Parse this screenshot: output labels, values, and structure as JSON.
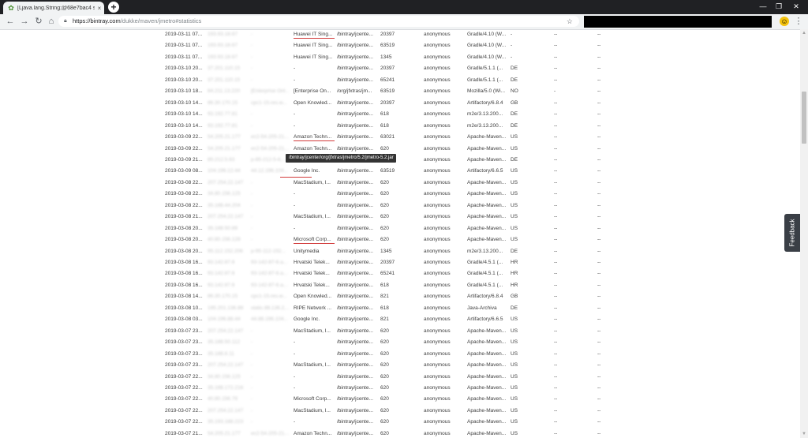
{
  "browser": {
    "tab_title": "[Ljava.lang.String;@68e7bac4 st",
    "tab_close": "×",
    "new_tab": "+",
    "url_host": "https://bintray.com",
    "url_path": "/dukke/maven/jmetro#statistics"
  },
  "tooltip": "/bintray/jcenter/org/jfxtras/jmetro/5.2/jmetro-5.2.jar",
  "feedback_label": "Feedback",
  "table": {
    "rows": [
      {
        "date": "2019-03-11 07...",
        "ip": "193.93.18.67",
        "host": "-",
        "org": "Huawei IT Sing...",
        "path": "/bintray/jcente...",
        "port": "20397",
        "user": "anonymous",
        "agent": "Gradle/4.10 (W...",
        "cc": "-",
        "x1": "--",
        "x2": "--",
        "ul": true
      },
      {
        "date": "2019-03-11 07...",
        "ip": "193.93.18.67",
        "host": "-",
        "org": "Huawei IT Sing...",
        "path": "/bintray/jcente...",
        "port": "63519",
        "user": "anonymous",
        "agent": "Gradle/4.10 (W...",
        "cc": "-",
        "x1": "--",
        "x2": "--",
        "ul": false
      },
      {
        "date": "2019-03-11 07...",
        "ip": "193.93.18.67",
        "host": "-",
        "org": "Huawei IT Sing...",
        "path": "/bintray/jcente...",
        "port": "1345",
        "user": "anonymous",
        "agent": "Gradle/4.10 (W...",
        "cc": "-",
        "x1": "--",
        "x2": "--",
        "ul": false
      },
      {
        "date": "2019-03-10 20...",
        "ip": "37.201.110.15",
        "host": "-",
        "org": "-",
        "path": "/bintray/jcente...",
        "port": "20397",
        "user": "anonymous",
        "agent": "Gradle/5.1.1 (...",
        "cc": "DE",
        "x1": "--",
        "x2": "--",
        "ul": false
      },
      {
        "date": "2019-03-10 20...",
        "ip": "37.201.110.15",
        "host": "-",
        "org": "-",
        "path": "/bintray/jcente...",
        "port": "65241",
        "user": "anonymous",
        "agent": "Gradle/5.1.1 (...",
        "cc": "DE",
        "x1": "--",
        "x2": "--",
        "ul": false
      },
      {
        "date": "2019-03-10 18...",
        "ip": "84.211.13.220",
        "host": "[Enterprise Onl...",
        "org": "[Enterprise On...",
        "path": "/org/jfxtras/jm...",
        "port": "63519",
        "user": "anonymous",
        "agent": "Mozilla/5.0 (Wi...",
        "cc": "NO",
        "x1": "-",
        "x2": "--",
        "ul": false
      },
      {
        "date": "2019-03-10 14...",
        "ip": "86.30.170.15",
        "host": "cpc1-15.res.w...",
        "org": "Open Knowled...",
        "path": "/bintray/jcente...",
        "port": "20397",
        "user": "anonymous",
        "agent": "Artifactory/6.8.4",
        "cc": "GB",
        "x1": "--",
        "x2": "--",
        "ul": false
      },
      {
        "date": "2019-03-10 14...",
        "ip": "93.192.77.81",
        "host": "-",
        "org": "-",
        "path": "/bintray/jcente...",
        "port": "618",
        "user": "anonymous",
        "agent": "m2e/3.13.200...",
        "cc": "DE",
        "x1": "--",
        "x2": "--",
        "ul": false
      },
      {
        "date": "2019-03-10 14...",
        "ip": "93.192.77.81",
        "host": "-",
        "org": "-",
        "path": "/bintray/jcente...",
        "port": "618",
        "user": "anonymous",
        "agent": "m2e/3.13.200...",
        "cc": "DE",
        "x1": "--",
        "x2": "--",
        "ul": false
      },
      {
        "date": "2019-03-09 22...",
        "ip": "54.205.21.177",
        "host": "ec2-54-205-21...",
        "org": "Amazon Techn...",
        "path": "/bintray/jcente...",
        "port": "63021",
        "user": "anonymous",
        "agent": "Apache-Maven...",
        "cc": "US",
        "x1": "--",
        "x2": "--",
        "ul": true
      },
      {
        "date": "2019-03-09 22...",
        "ip": "54.205.21.177",
        "host": "ec2-54-205-21...",
        "org": "Amazon Techn...",
        "path": "/bintray/jcente...",
        "port": "620",
        "user": "anonymous",
        "agent": "Apache-Maven...",
        "cc": "US",
        "x1": "--",
        "x2": "--",
        "ul": false
      },
      {
        "date": "2019-03-09 21...",
        "ip": "85.212.5.63",
        "host": "p-85-212-5-6...",
        "org": "-",
        "path": "/bintray/jcente...",
        "port": "620",
        "user": "anonymous",
        "agent": "Apache-Maven...",
        "cc": "DE",
        "x1": "--",
        "x2": "--",
        "ul": false
      },
      {
        "date": "2019-03-09 08...",
        "ip": "104.196.12.44",
        "host": "44.12.196.104...",
        "org": "Google Inc.",
        "path": "/bintray/jcente...",
        "port": "63519",
        "user": "anonymous",
        "agent": "Artifactory/6.6.5",
        "cc": "US",
        "x1": "--",
        "x2": "--",
        "ul": false
      },
      {
        "date": "2019-03-08 22...",
        "ip": "207.254.22.147",
        "host": "-",
        "org": "MacStadium, I...",
        "path": "/bintray/jcente...",
        "port": "620",
        "user": "anonymous",
        "agent": "Apache-Maven...",
        "cc": "US",
        "x1": "--",
        "x2": "--",
        "ul": false
      },
      {
        "date": "2019-03-08 22...",
        "ip": "34.80.156.125",
        "host": "-",
        "org": "-",
        "path": "/bintray/jcente...",
        "port": "620",
        "user": "anonymous",
        "agent": "Apache-Maven...",
        "cc": "US",
        "x1": "--",
        "x2": "--",
        "ul": false
      },
      {
        "date": "2019-03-08 22...",
        "ip": "35.188.44.204",
        "host": "-",
        "org": "-",
        "path": "/bintray/jcente...",
        "port": "620",
        "user": "anonymous",
        "agent": "Apache-Maven...",
        "cc": "US",
        "x1": "--",
        "x2": "--",
        "ul": false
      },
      {
        "date": "2019-03-08 21...",
        "ip": "207.254.22.147",
        "host": "-",
        "org": "MacStadium, I...",
        "path": "/bintray/jcente...",
        "port": "620",
        "user": "anonymous",
        "agent": "Apache-Maven...",
        "cc": "US",
        "x1": "--",
        "x2": "--",
        "ul": false
      },
      {
        "date": "2019-03-08 20...",
        "ip": "35.188.50.89",
        "host": "-",
        "org": "-",
        "path": "/bintray/jcente...",
        "port": "620",
        "user": "anonymous",
        "agent": "Apache-Maven...",
        "cc": "US",
        "x1": "--",
        "x2": "--",
        "ul": false
      },
      {
        "date": "2019-03-08 20...",
        "ip": "40.80.156.128",
        "host": "-",
        "org": "Microsoft Corp...",
        "path": "/bintray/jcente...",
        "port": "620",
        "user": "anonymous",
        "agent": "Apache-Maven...",
        "cc": "US",
        "x1": "--",
        "x2": "--",
        "ul": true
      },
      {
        "date": "2019-03-08 20...",
        "ip": "95.112.152.206",
        "host": "p-95-112-152...",
        "org": "Unitymedia",
        "path": "/bintray/jcente...",
        "port": "1345",
        "user": "anonymous",
        "agent": "m2e/3.13.200...",
        "cc": "DE",
        "x1": "--",
        "x2": "--",
        "ul": false
      },
      {
        "date": "2019-03-08 16...",
        "ip": "93.142.87.6",
        "host": "93-142-87-6.a...",
        "org": "Hrvatski Telek...",
        "path": "/bintray/jcente...",
        "port": "20397",
        "user": "anonymous",
        "agent": "Gradle/4.5.1 (...",
        "cc": "HR",
        "x1": "--",
        "x2": "--",
        "ul": false
      },
      {
        "date": "2019-03-08 16...",
        "ip": "93.142.87.6",
        "host": "93-142-87-6.a...",
        "org": "Hrvatski Telek...",
        "path": "/bintray/jcente...",
        "port": "65241",
        "user": "anonymous",
        "agent": "Gradle/4.5.1 (...",
        "cc": "HR",
        "x1": "--",
        "x2": "--",
        "ul": false
      },
      {
        "date": "2019-03-08 16...",
        "ip": "93.142.87.6",
        "host": "93-142-87-6.a...",
        "org": "Hrvatski Telek...",
        "path": "/bintray/jcente...",
        "port": "618",
        "user": "anonymous",
        "agent": "Gradle/4.5.1 (...",
        "cc": "HR",
        "x1": "--",
        "x2": "--",
        "ul": false
      },
      {
        "date": "2019-03-08 14...",
        "ip": "86.30.170.15",
        "host": "cpc1-15.res.w...",
        "org": "Open Knowled...",
        "path": "/bintray/jcente...",
        "port": "821",
        "user": "anonymous",
        "agent": "Artifactory/6.8.4",
        "cc": "GB",
        "x1": "--",
        "x2": "--",
        "ul": false
      },
      {
        "date": "2019-03-08 10...",
        "ip": "195.201.136.88",
        "host": "static.88.136.2...",
        "org": "RIPE Network ...",
        "path": "/bintray/jcente...",
        "port": "618",
        "user": "anonymous",
        "agent": "Java-Archiva",
        "cc": "DE",
        "x1": "--",
        "x2": "--",
        "ul": false
      },
      {
        "date": "2019-03-08 03...",
        "ip": "104.196.88.44",
        "host": "44.88.196.104...",
        "org": "Google Inc.",
        "path": "/bintray/jcente...",
        "port": "821",
        "user": "anonymous",
        "agent": "Artifactory/6.6.5",
        "cc": "US",
        "x1": "--",
        "x2": "--",
        "ul": false
      },
      {
        "date": "2019-03-07 23...",
        "ip": "207.254.22.147",
        "host": "-",
        "org": "MacStadium, I...",
        "path": "/bintray/jcente...",
        "port": "620",
        "user": "anonymous",
        "agent": "Apache-Maven...",
        "cc": "US",
        "x1": "--",
        "x2": "--",
        "ul": false
      },
      {
        "date": "2019-03-07 23...",
        "ip": "35.188.50.112",
        "host": "-",
        "org": "-",
        "path": "/bintray/jcente...",
        "port": "620",
        "user": "anonymous",
        "agent": "Apache-Maven...",
        "cc": "US",
        "x1": "--",
        "x2": "--",
        "ul": false
      },
      {
        "date": "2019-03-07 23...",
        "ip": "35.188.8.11",
        "host": "-",
        "org": "-",
        "path": "/bintray/jcente...",
        "port": "620",
        "user": "anonymous",
        "agent": "Apache-Maven...",
        "cc": "US",
        "x1": "--",
        "x2": "--",
        "ul": false
      },
      {
        "date": "2019-03-07 23...",
        "ip": "207.254.22.147",
        "host": "-",
        "org": "MacStadium, I...",
        "path": "/bintray/jcente...",
        "port": "620",
        "user": "anonymous",
        "agent": "Apache-Maven...",
        "cc": "US",
        "x1": "--",
        "x2": "--",
        "ul": false
      },
      {
        "date": "2019-03-07 22...",
        "ip": "34.80.156.125",
        "host": "-",
        "org": "-",
        "path": "/bintray/jcente...",
        "port": "620",
        "user": "anonymous",
        "agent": "Apache-Maven...",
        "cc": "US",
        "x1": "--",
        "x2": "--",
        "ul": false
      },
      {
        "date": "2019-03-07 22...",
        "ip": "35.188.172.216",
        "host": "-",
        "org": "-",
        "path": "/bintray/jcente...",
        "port": "620",
        "user": "anonymous",
        "agent": "Apache-Maven...",
        "cc": "US",
        "x1": "--",
        "x2": "--",
        "ul": false
      },
      {
        "date": "2019-03-07 22...",
        "ip": "40.80.156.79",
        "host": "-",
        "org": "Microsoft Corp...",
        "path": "/bintray/jcente...",
        "port": "620",
        "user": "anonymous",
        "agent": "Apache-Maven...",
        "cc": "US",
        "x1": "--",
        "x2": "--",
        "ul": false
      },
      {
        "date": "2019-03-07 22...",
        "ip": "207.254.22.147",
        "host": "-",
        "org": "MacStadium, I...",
        "path": "/bintray/jcente...",
        "port": "620",
        "user": "anonymous",
        "agent": "Apache-Maven...",
        "cc": "US",
        "x1": "--",
        "x2": "--",
        "ul": false
      },
      {
        "date": "2019-03-07 22...",
        "ip": "35.193.188.223",
        "host": "-",
        "org": "-",
        "path": "/bintray/jcente...",
        "port": "620",
        "user": "anonymous",
        "agent": "Apache-Maven...",
        "cc": "US",
        "x1": "--",
        "x2": "--",
        "ul": false
      },
      {
        "date": "2019-03-07 21...",
        "ip": "54.205.21.177",
        "host": "ec2-54-205-21...",
        "org": "Amazon Techn...",
        "path": "/bintray/jcente...",
        "port": "620",
        "user": "anonymous",
        "agent": "Apache-Maven...",
        "cc": "US",
        "x1": "--",
        "x2": "--",
        "ul": false
      }
    ]
  }
}
